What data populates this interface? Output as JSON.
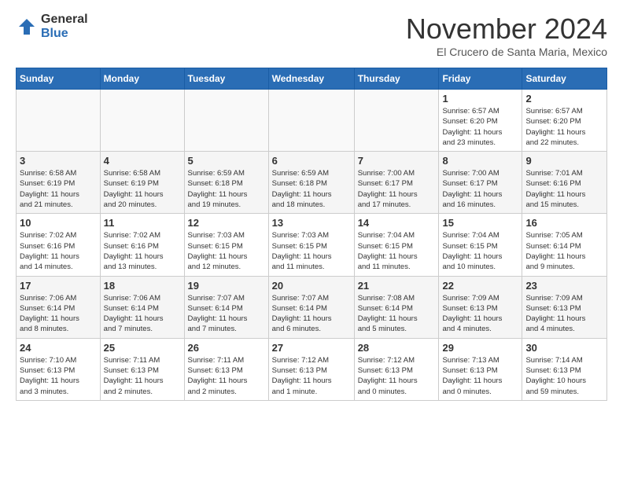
{
  "logo": {
    "general": "General",
    "blue": "Blue"
  },
  "header": {
    "month": "November 2024",
    "location": "El Crucero de Santa Maria, Mexico"
  },
  "weekdays": [
    "Sunday",
    "Monday",
    "Tuesday",
    "Wednesday",
    "Thursday",
    "Friday",
    "Saturday"
  ],
  "weeks": [
    [
      {
        "day": "",
        "info": ""
      },
      {
        "day": "",
        "info": ""
      },
      {
        "day": "",
        "info": ""
      },
      {
        "day": "",
        "info": ""
      },
      {
        "day": "",
        "info": ""
      },
      {
        "day": "1",
        "info": "Sunrise: 6:57 AM\nSunset: 6:20 PM\nDaylight: 11 hours\nand 23 minutes."
      },
      {
        "day": "2",
        "info": "Sunrise: 6:57 AM\nSunset: 6:20 PM\nDaylight: 11 hours\nand 22 minutes."
      }
    ],
    [
      {
        "day": "3",
        "info": "Sunrise: 6:58 AM\nSunset: 6:19 PM\nDaylight: 11 hours\nand 21 minutes."
      },
      {
        "day": "4",
        "info": "Sunrise: 6:58 AM\nSunset: 6:19 PM\nDaylight: 11 hours\nand 20 minutes."
      },
      {
        "day": "5",
        "info": "Sunrise: 6:59 AM\nSunset: 6:18 PM\nDaylight: 11 hours\nand 19 minutes."
      },
      {
        "day": "6",
        "info": "Sunrise: 6:59 AM\nSunset: 6:18 PM\nDaylight: 11 hours\nand 18 minutes."
      },
      {
        "day": "7",
        "info": "Sunrise: 7:00 AM\nSunset: 6:17 PM\nDaylight: 11 hours\nand 17 minutes."
      },
      {
        "day": "8",
        "info": "Sunrise: 7:00 AM\nSunset: 6:17 PM\nDaylight: 11 hours\nand 16 minutes."
      },
      {
        "day": "9",
        "info": "Sunrise: 7:01 AM\nSunset: 6:16 PM\nDaylight: 11 hours\nand 15 minutes."
      }
    ],
    [
      {
        "day": "10",
        "info": "Sunrise: 7:02 AM\nSunset: 6:16 PM\nDaylight: 11 hours\nand 14 minutes."
      },
      {
        "day": "11",
        "info": "Sunrise: 7:02 AM\nSunset: 6:16 PM\nDaylight: 11 hours\nand 13 minutes."
      },
      {
        "day": "12",
        "info": "Sunrise: 7:03 AM\nSunset: 6:15 PM\nDaylight: 11 hours\nand 12 minutes."
      },
      {
        "day": "13",
        "info": "Sunrise: 7:03 AM\nSunset: 6:15 PM\nDaylight: 11 hours\nand 11 minutes."
      },
      {
        "day": "14",
        "info": "Sunrise: 7:04 AM\nSunset: 6:15 PM\nDaylight: 11 hours\nand 11 minutes."
      },
      {
        "day": "15",
        "info": "Sunrise: 7:04 AM\nSunset: 6:15 PM\nDaylight: 11 hours\nand 10 minutes."
      },
      {
        "day": "16",
        "info": "Sunrise: 7:05 AM\nSunset: 6:14 PM\nDaylight: 11 hours\nand 9 minutes."
      }
    ],
    [
      {
        "day": "17",
        "info": "Sunrise: 7:06 AM\nSunset: 6:14 PM\nDaylight: 11 hours\nand 8 minutes."
      },
      {
        "day": "18",
        "info": "Sunrise: 7:06 AM\nSunset: 6:14 PM\nDaylight: 11 hours\nand 7 minutes."
      },
      {
        "day": "19",
        "info": "Sunrise: 7:07 AM\nSunset: 6:14 PM\nDaylight: 11 hours\nand 7 minutes."
      },
      {
        "day": "20",
        "info": "Sunrise: 7:07 AM\nSunset: 6:14 PM\nDaylight: 11 hours\nand 6 minutes."
      },
      {
        "day": "21",
        "info": "Sunrise: 7:08 AM\nSunset: 6:14 PM\nDaylight: 11 hours\nand 5 minutes."
      },
      {
        "day": "22",
        "info": "Sunrise: 7:09 AM\nSunset: 6:13 PM\nDaylight: 11 hours\nand 4 minutes."
      },
      {
        "day": "23",
        "info": "Sunrise: 7:09 AM\nSunset: 6:13 PM\nDaylight: 11 hours\nand 4 minutes."
      }
    ],
    [
      {
        "day": "24",
        "info": "Sunrise: 7:10 AM\nSunset: 6:13 PM\nDaylight: 11 hours\nand 3 minutes."
      },
      {
        "day": "25",
        "info": "Sunrise: 7:11 AM\nSunset: 6:13 PM\nDaylight: 11 hours\nand 2 minutes."
      },
      {
        "day": "26",
        "info": "Sunrise: 7:11 AM\nSunset: 6:13 PM\nDaylight: 11 hours\nand 2 minutes."
      },
      {
        "day": "27",
        "info": "Sunrise: 7:12 AM\nSunset: 6:13 PM\nDaylight: 11 hours\nand 1 minute."
      },
      {
        "day": "28",
        "info": "Sunrise: 7:12 AM\nSunset: 6:13 PM\nDaylight: 11 hours\nand 0 minutes."
      },
      {
        "day": "29",
        "info": "Sunrise: 7:13 AM\nSunset: 6:13 PM\nDaylight: 11 hours\nand 0 minutes."
      },
      {
        "day": "30",
        "info": "Sunrise: 7:14 AM\nSunset: 6:13 PM\nDaylight: 10 hours\nand 59 minutes."
      }
    ]
  ]
}
